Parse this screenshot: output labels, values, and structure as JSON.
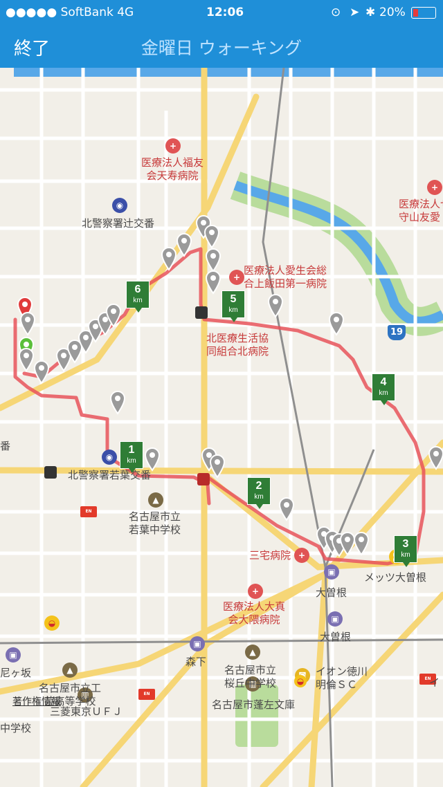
{
  "status_bar": {
    "carrier": "●●●●● SoftBank   4G",
    "time": "12:06",
    "battery": "20%"
  },
  "nav": {
    "done_label": "終了",
    "title": "金曜日 ウォーキング"
  },
  "map": {
    "labels": {
      "hosp_fukuyu": "医療法人福友\n会天寿病院",
      "police_tsuji": "北警察署辻交番",
      "hosp_aisei": "医療法人愛生会総\n合上飯田第一病院",
      "kita_clinic": "北医療生活協\n同組合北病院",
      "hosp_moriyama": "医療法人せ\n守山友愛",
      "police_wakaba": "北警察署若葉交番",
      "school_wakaba": "名古屋市立\n若葉中学校",
      "sanyaku": "三宅病院",
      "ozone": "大曽根",
      "ozone2": "大曽根",
      "hosp_okuma": "医療法人大真\n会大隈病院",
      "morishita": "森下",
      "school_sakuraoka": "名古屋市立\n桜丘中学校",
      "school_kogei": "名古屋市立工\n芸高等学校",
      "amagasaka": "尼ヶ坂",
      "aeon": "イオン徳川\n明倫ＳＣ",
      "metz": "メッツ大曽根",
      "hosa_bunko": "名古屋市蓬左文庫",
      "mufg": "三菱東京ＵＦＪ",
      "junior_high": "中学校",
      "copyright": "著作権情報",
      "ban": "番",
      "kanji_i": "イ"
    },
    "route19": "19",
    "km_markers": [
      "1",
      "2",
      "3",
      "4",
      "5",
      "6"
    ],
    "km_unit": "km",
    "colors": {
      "route": "#e8535a",
      "river": "#58a8e8",
      "park": "#b9dc9c",
      "major_road": "#f6d676",
      "km_marker": "#2f7d36",
      "nav": "#1f8fd8"
    }
  }
}
